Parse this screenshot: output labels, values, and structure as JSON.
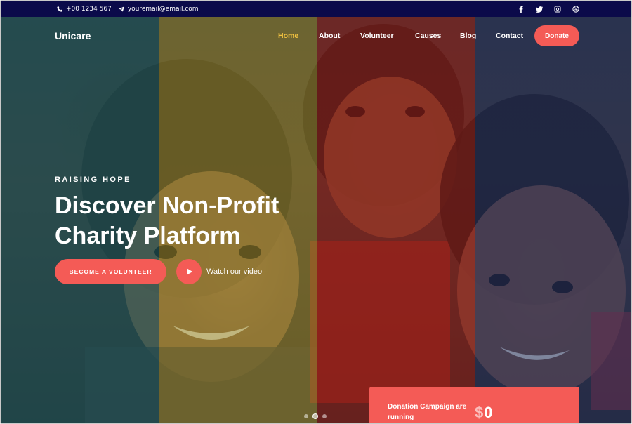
{
  "topbar": {
    "phone": "+00 1234 567",
    "email": "youremail@email.com",
    "social_icons": [
      "facebook-icon",
      "twitter-icon",
      "instagram-icon",
      "dribbble-icon"
    ]
  },
  "nav": {
    "brand": "Unicare",
    "items": [
      {
        "label": "Home",
        "active": true
      },
      {
        "label": "About",
        "active": false
      },
      {
        "label": "Volunteer",
        "active": false
      },
      {
        "label": "Causes",
        "active": false
      },
      {
        "label": "Blog",
        "active": false
      },
      {
        "label": "Contact",
        "active": false
      }
    ],
    "donate_label": "Donate"
  },
  "hero": {
    "kicker": "RAISING HOPE",
    "headline_line1": "Discover Non-Profit",
    "headline_line2": "Charity Platform",
    "cta_label": "BECOME A VOLUNTEER",
    "watch_label": "Watch our video",
    "slides_count": 3,
    "active_slide": 2
  },
  "donation_card": {
    "label": "Donation Campaign are running",
    "currency": "$",
    "amount": "0"
  },
  "colors": {
    "topbar_bg": "#0b0a4a",
    "accent": "#f45b56",
    "active_nav": "#f3c340",
    "band_teal": "#19555a",
    "band_olive": "#96872d",
    "band_red": "#961914",
    "band_navy": "#1e2d5f"
  }
}
